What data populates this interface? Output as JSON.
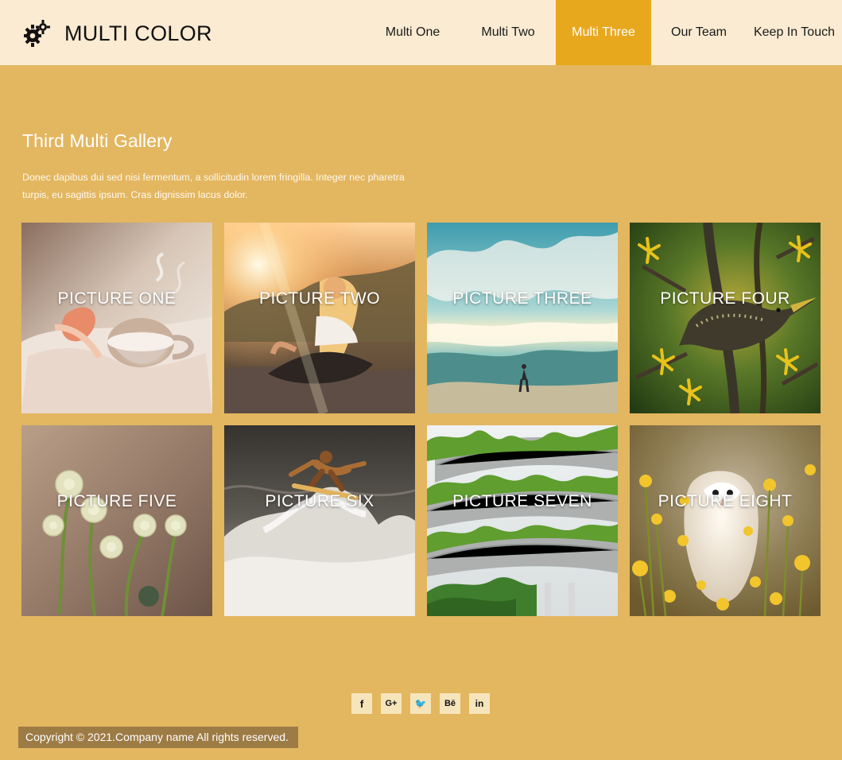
{
  "brand": {
    "title": "MULTI COLOR",
    "icon": "gears-icon"
  },
  "nav": {
    "items": [
      {
        "label": "Multi One",
        "active": false
      },
      {
        "label": "Multi Two",
        "active": false
      },
      {
        "label": "Multi Three",
        "active": true
      },
      {
        "label": "Our Team",
        "active": false
      },
      {
        "label": "Keep In Touch",
        "active": false
      }
    ]
  },
  "section": {
    "title": "Third Multi Gallery",
    "description": "Donec dapibus dui sed nisi fermentum, a sollicitudin lorem fringilla. Integer nec pharetra turpis, eu sagittis ipsum. Cras dignissim lacus dolor."
  },
  "gallery": {
    "items": [
      {
        "label": "PICTURE ONE",
        "subject": "tea cup on an open book"
      },
      {
        "label": "PICTURE TWO",
        "subject": "woman sitting by a lake at sunset"
      },
      {
        "label": "PICTURE THREE",
        "subject": "person standing on a beach under clouds"
      },
      {
        "label": "PICTURE FOUR",
        "subject": "starling bird on a flowering branch"
      },
      {
        "label": "PICTURE FIVE",
        "subject": "pale wildflowers against a mauve background"
      },
      {
        "label": "PICTURE SIX",
        "subject": "surfer on a breaking wave"
      },
      {
        "label": "PICTURE SEVEN",
        "subject": "green terraced building"
      },
      {
        "label": "PICTURE EIGHT",
        "subject": "barn owl among yellow flowers"
      }
    ]
  },
  "social": {
    "items": [
      {
        "label": "f",
        "icon": "facebook-icon"
      },
      {
        "label": "G+",
        "icon": "google-plus-icon"
      },
      {
        "label": "🐦",
        "icon": "twitter-icon"
      },
      {
        "label": "Bē",
        "icon": "behance-icon"
      },
      {
        "label": "in",
        "icon": "linkedin-icon"
      }
    ]
  },
  "footer": {
    "copyright": "Copyright © 2021.Company name All rights reserved."
  },
  "colors": {
    "page_background": "#e3b660",
    "header_background": "#faebd2",
    "active_nav": "#e8a81e",
    "footer_badge": "#9d7b45"
  }
}
